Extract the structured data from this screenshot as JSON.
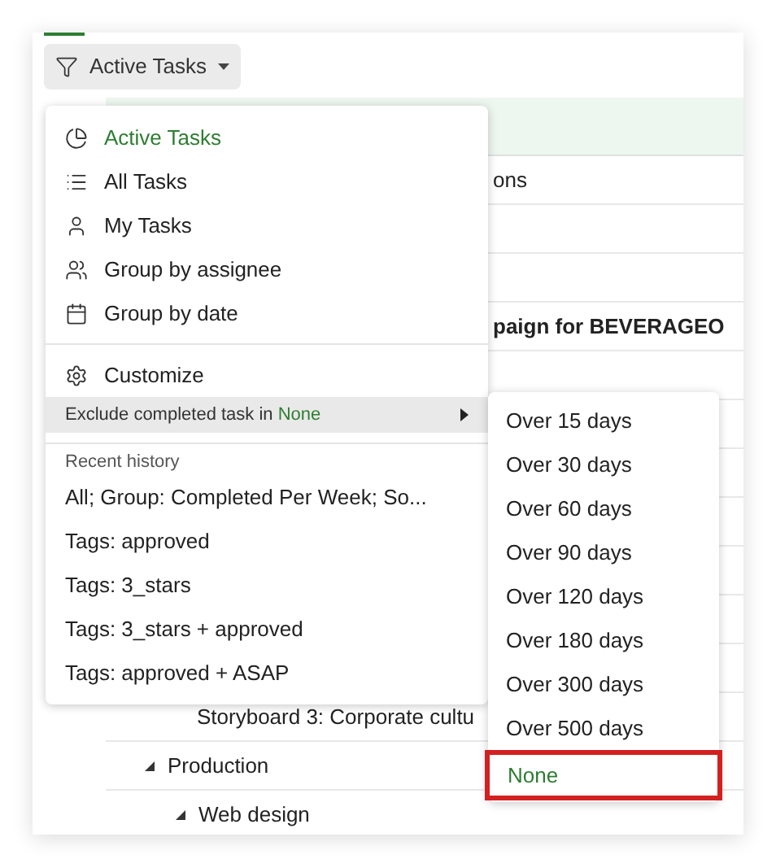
{
  "toolbar": {
    "filter_button": "Active Tasks"
  },
  "table": {
    "rows": [
      {
        "kind": "covered",
        "text": "ons"
      },
      {
        "kind": "blank"
      },
      {
        "kind": "blank"
      },
      {
        "kind": "covered_bold",
        "text": "paign for BEVERAGEO"
      },
      {
        "kind": "blank"
      },
      {
        "kind": "blank"
      },
      {
        "kind": "blank"
      },
      {
        "kind": "blank"
      },
      {
        "kind": "blank"
      },
      {
        "kind": "blank"
      },
      {
        "kind": "blank"
      },
      {
        "kind": "leaf",
        "text": "Storyboard 3: Corporate cultu"
      },
      {
        "kind": "group",
        "text": "Production",
        "children": [
          {
            "kind": "group",
            "text": "Web design"
          }
        ]
      }
    ]
  },
  "menu": {
    "views": [
      {
        "label": "Active Tasks",
        "selected": true
      },
      {
        "label": "All Tasks",
        "selected": false
      },
      {
        "label": "My Tasks",
        "selected": false
      },
      {
        "label": "Group by assignee",
        "selected": false
      },
      {
        "label": "Group by date",
        "selected": false
      }
    ],
    "customize": "Customize",
    "exclude": {
      "label": "Exclude completed task in",
      "value": "None",
      "highlighted": true
    },
    "history_heading": "Recent history",
    "history": [
      "All; Group: Completed Per Week; So...",
      "Tags: approved",
      "Tags: 3_stars",
      "Tags: 3_stars + approved",
      "Tags: approved + ASAP"
    ]
  },
  "submenu": [
    {
      "label": "Over 15 days",
      "selected": false
    },
    {
      "label": "Over 30 days",
      "selected": false
    },
    {
      "label": "Over 60 days",
      "selected": false
    },
    {
      "label": "Over 90 days",
      "selected": false
    },
    {
      "label": "Over 120 days",
      "selected": false
    },
    {
      "label": "Over 180 days",
      "selected": false
    },
    {
      "label": "Over 300 days",
      "selected": false
    },
    {
      "label": "Over 500 days",
      "selected": false
    },
    {
      "label": "None",
      "selected": true
    }
  ]
}
